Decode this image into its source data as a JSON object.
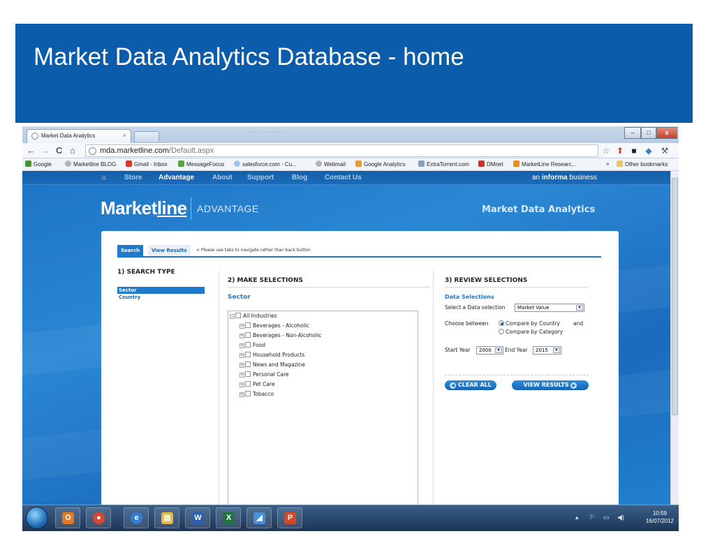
{
  "slide": {
    "title": "Market Data Analytics Database - home",
    "header_color": "#0b5cab"
  },
  "browser": {
    "tab_title": "Market Data Analytics",
    "tab_close": "×",
    "blurred_window_title": "—— — — ———",
    "window_buttons": [
      "–",
      "□",
      "x"
    ],
    "url_host": "mda.marketline.com",
    "url_path": "/Default.aspx",
    "nav_icons": [
      "back-arrow-icon",
      "forward-arrow-icon",
      "reload-icon",
      "home-icon"
    ],
    "nav_glyphs": [
      "←",
      "→",
      "C",
      "⌂"
    ],
    "toolbar_glyphs": [
      "☆",
      "⬆",
      "■",
      "◆",
      "⚒"
    ],
    "bookmarks": [
      {
        "label": "Google",
        "color": "#4a8f3a"
      },
      {
        "label": "Marketline BLOG",
        "color": "#b0b7bf"
      },
      {
        "label": "Gmail - Inbox",
        "color": "#d23b2f"
      },
      {
        "label": "MessageFocus",
        "color": "#5aa43c"
      },
      {
        "label": "salesforce.com - Cu...",
        "color": "#9fc4e8"
      },
      {
        "label": "Webmail",
        "color": "#b0b7bf"
      },
      {
        "label": "Google Analytics",
        "color": "#e89a2c"
      },
      {
        "label": "ExtraTorrent.com",
        "color": "#8aa0b8"
      },
      {
        "label": "DMnet",
        "color": "#c2352c"
      },
      {
        "label": "MarketLine Researc...",
        "color": "#f08a1c"
      }
    ],
    "bookmarks_more": "»",
    "other_bookmarks": "Other bookmarks"
  },
  "site": {
    "nav_home_glyph": "⌂",
    "nav": [
      "Store",
      "Advantage",
      "About",
      "Support",
      "Blog",
      "Contact Us"
    ],
    "active_nav": "Advantage",
    "informa_prefix": "an ",
    "informa_brand": "informa",
    "informa_suffix": " business",
    "logo_a": "Market",
    "logo_b": "line",
    "logo_sub": "ADVANTAGE",
    "heading": "Market Data Analytics",
    "tabs": [
      "Search",
      "View Results"
    ],
    "tab_note": "< Please use tabs to navigate rather than back button",
    "search_type": {
      "title": "1) SEARCH TYPE",
      "items": [
        "Sector",
        "Country"
      ],
      "selected": "Sector"
    },
    "make_selections": {
      "title": "2) MAKE SELECTIONS",
      "label": "Sector",
      "root": "All Industries",
      "root_toggle": "−",
      "child_toggle": "+",
      "children": [
        "Beverages - Alcoholic",
        "Beverages - Non-Alcoholic",
        "Food",
        "Household Products",
        "News and Magazine",
        "Personal Care",
        "Pet Care",
        "Tobacco"
      ]
    },
    "review": {
      "title": "3) REVIEW SELECTIONS",
      "label": "Data Selections",
      "select_prompt": "Select a Data selection",
      "data_selection": "Market Value",
      "choose_label": "Choose between",
      "radio_country": "Compare by Country",
      "radio_category": "Compare by Category",
      "and_text": "and",
      "start_year_label": "Start Year",
      "start_year": "2000",
      "end_year_label": "End Year",
      "end_year": "2015",
      "dropdown_glyph": "▾",
      "clear_all": "CLEAR ALL",
      "view_results": "VIEW RESULTS",
      "clear_icon_glyph": "◀",
      "view_icon_glyph": "▶"
    }
  },
  "taskbar": {
    "apps": [
      "outlook",
      "chrome",
      "internet-explorer",
      "file-explorer",
      "word",
      "excel",
      "communicator",
      "powerpoint"
    ],
    "app_glyphs": [
      "O",
      "●",
      "e",
      "▤",
      "W",
      "X",
      "◢",
      "P"
    ],
    "app_colors": [
      "#e07b23",
      "#d64933",
      "#2f7ed8",
      "#e3b94b",
      "#2b5fb2",
      "#217346",
      "#4a90d9",
      "#d24726"
    ],
    "tray_glyphs": [
      "▴",
      "⚐",
      "▭",
      "◀)"
    ],
    "clock_time": "10:59",
    "clock_date": "16/07/2012"
  }
}
